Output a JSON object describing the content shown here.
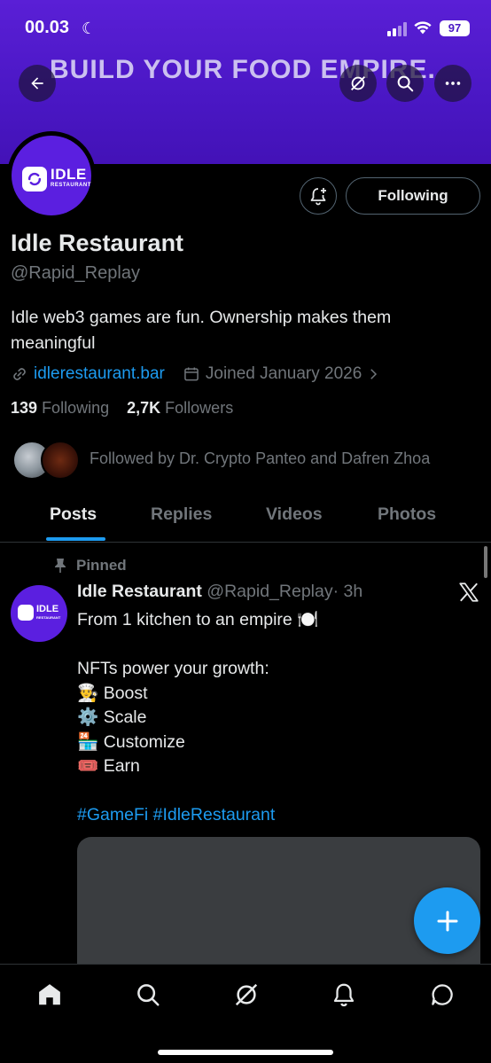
{
  "status_bar": {
    "time": "00.03",
    "battery": "97"
  },
  "banner": {
    "text": "BUILD YOUR FOOD EMPIRE."
  },
  "avatar": {
    "logo_title": "IDLE",
    "logo_subtitle": "RESTAURANT"
  },
  "profile": {
    "name": "Idle Restaurant",
    "handle": "@Rapid_Replay",
    "bio": "Idle web3 games are fun. Ownership makes them meaningful",
    "link": "idlerestaurant.bar",
    "joined": "Joined January 2026",
    "following_count": "139",
    "following_label": "Following",
    "followers_count": "2,7K",
    "followers_label": "Followers",
    "followed_by": "Followed by Dr. Crypto Panteo and Dafren Zhoa",
    "follow_button": "Following"
  },
  "tabs": [
    {
      "label": "Posts",
      "active": true
    },
    {
      "label": "Replies",
      "active": false
    },
    {
      "label": "Videos",
      "active": false
    },
    {
      "label": "Photos",
      "active": false
    }
  ],
  "post": {
    "pinned_label": "Pinned",
    "author_name": "Idle Restaurant",
    "author_handle": "@Rapid_Replay",
    "time": "· 3h",
    "lines": [
      "From 1 kitchen to an empire 🍽️",
      "",
      "NFTs power your growth:",
      "👨‍🍳 Boost",
      "⚙️ Scale",
      "🏪 Customize",
      "🎟️ Earn",
      ""
    ],
    "hashtags": "#GameFi #IdleRestaurant"
  },
  "colors": {
    "accent": "#1d9bf0",
    "banner": "#4a17c4",
    "brand": "#5b1fe0",
    "muted": "#71767b"
  },
  "icons": {
    "back": "arrow-left-icon",
    "grok": "grok-icon",
    "search": "search-icon",
    "more": "more-icon",
    "bell": "bell-plus-icon",
    "fab": "plus-icon",
    "nav": [
      "home-icon",
      "search-icon",
      "grok-icon",
      "bell-icon",
      "messages-icon"
    ]
  }
}
